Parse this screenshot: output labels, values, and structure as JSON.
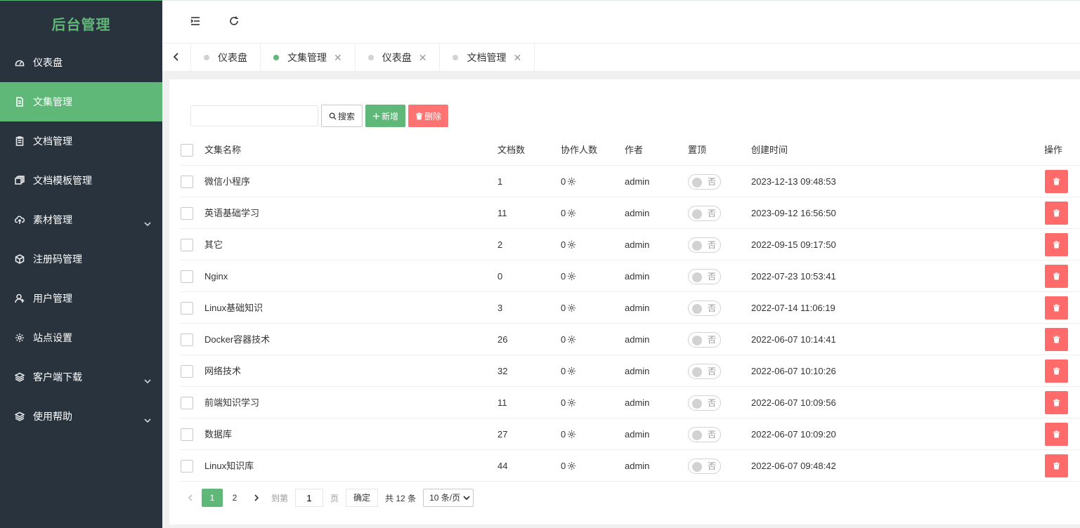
{
  "app": {
    "title": "后台管理"
  },
  "sidebar": {
    "items": [
      {
        "label": "仪表盘",
        "icon": "dashboard-icon",
        "active": false,
        "has_sub": false
      },
      {
        "label": "文集管理",
        "icon": "document-icon",
        "active": true,
        "has_sub": false
      },
      {
        "label": "文档管理",
        "icon": "clipboard-icon",
        "active": false,
        "has_sub": false
      },
      {
        "label": "文档模板管理",
        "icon": "template-icon",
        "active": false,
        "has_sub": false
      },
      {
        "label": "素材管理",
        "icon": "cloud-upload-icon",
        "active": false,
        "has_sub": true
      },
      {
        "label": "注册码管理",
        "icon": "cube-icon",
        "active": false,
        "has_sub": false
      },
      {
        "label": "用户管理",
        "icon": "user-icon",
        "active": false,
        "has_sub": false
      },
      {
        "label": "站点设置",
        "icon": "gear-icon",
        "active": false,
        "has_sub": false
      },
      {
        "label": "客户端下载",
        "icon": "layers-icon",
        "active": false,
        "has_sub": true
      },
      {
        "label": "使用帮助",
        "icon": "layers-icon",
        "active": false,
        "has_sub": true
      }
    ]
  },
  "header": {
    "menu_toggle_icon": "indent-icon",
    "refresh_icon": "refresh-icon"
  },
  "tabs": [
    {
      "label": "仪表盘",
      "active": false,
      "closable": false
    },
    {
      "label": "文集管理",
      "active": true,
      "closable": true
    },
    {
      "label": "仪表盘",
      "active": false,
      "closable": true
    },
    {
      "label": "文档管理",
      "active": false,
      "closable": true
    }
  ],
  "toolbar": {
    "search_value": "",
    "search_label": "搜索",
    "add_label": "新增",
    "delete_label": "删除"
  },
  "table": {
    "columns": [
      "文集名称",
      "文档数",
      "协作人数",
      "作者",
      "置顶",
      "创建时间",
      "操作"
    ],
    "rows": [
      {
        "name": "微信小程序",
        "docs": "1",
        "collab": "0",
        "author": "admin",
        "top": "否",
        "created": "2023-12-13 09:48:53"
      },
      {
        "name": "英语基础学习",
        "docs": "11",
        "collab": "0",
        "author": "admin",
        "top": "否",
        "created": "2023-09-12 16:56:50"
      },
      {
        "name": "其它",
        "docs": "2",
        "collab": "0",
        "author": "admin",
        "top": "否",
        "created": "2022-09-15 09:17:50"
      },
      {
        "name": "Nginx",
        "docs": "0",
        "collab": "0",
        "author": "admin",
        "top": "否",
        "created": "2022-07-23 10:53:41"
      },
      {
        "name": "Linux基础知识",
        "docs": "3",
        "collab": "0",
        "author": "admin",
        "top": "否",
        "created": "2022-07-14 11:06:19"
      },
      {
        "name": "Docker容器技术",
        "docs": "26",
        "collab": "0",
        "author": "admin",
        "top": "否",
        "created": "2022-06-07 10:14:41"
      },
      {
        "name": "网络技术",
        "docs": "32",
        "collab": "0",
        "author": "admin",
        "top": "否",
        "created": "2022-06-07 10:10:26"
      },
      {
        "name": "前端知识学习",
        "docs": "11",
        "collab": "0",
        "author": "admin",
        "top": "否",
        "created": "2022-06-07 10:09:56"
      },
      {
        "name": "数据库",
        "docs": "27",
        "collab": "0",
        "author": "admin",
        "top": "否",
        "created": "2022-06-07 10:09:20"
      },
      {
        "name": "Linux知识库",
        "docs": "44",
        "collab": "0",
        "author": "admin",
        "top": "否",
        "created": "2022-06-07 09:48:42"
      }
    ]
  },
  "pagination": {
    "pages": [
      "1",
      "2"
    ],
    "current": "1",
    "goto_label": "到第",
    "goto_value": "1",
    "page_unit": "页",
    "confirm_label": "确定",
    "total_text": "共 12 条",
    "page_size": "10 条/页"
  },
  "colors": {
    "accent": "#5fb878",
    "danger": "#ff6b6b",
    "sidebar_bg": "#28333e"
  }
}
